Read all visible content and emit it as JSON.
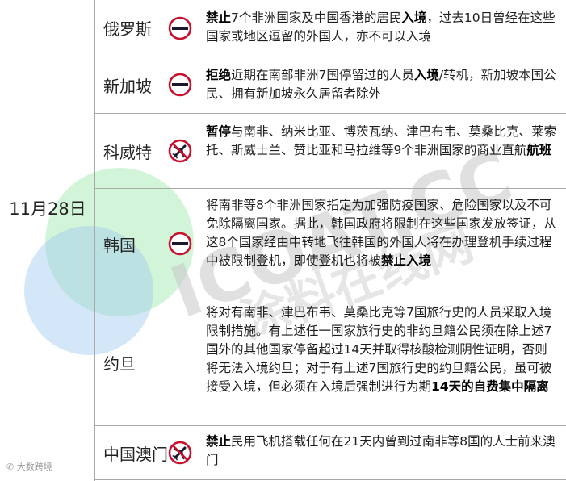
{
  "date": "11月28日",
  "rows": [
    {
      "country": "俄罗斯",
      "icon": "no-entry-icon",
      "text": [
        {
          "b": "禁止"
        },
        {
          "t": "7个非洲国家及中国香港的居民"
        },
        {
          "b": "入境"
        },
        {
          "t": "，过去10日曾经在这些国家或地区逗留的外国人，亦不可以入境"
        }
      ]
    },
    {
      "country": "新加坡",
      "icon": "no-entry-icon",
      "text": [
        {
          "b": "拒绝"
        },
        {
          "t": "近期在南部非洲7国停留过的人员"
        },
        {
          "b": "入境"
        },
        {
          "t": "/转机，新加坡本国公民、拥有新加坡永久居留者除外"
        }
      ]
    },
    {
      "country": "科威特",
      "icon": "no-flights-icon",
      "text": [
        {
          "b": "暂停"
        },
        {
          "t": "与南非、纳米比亚、博茨瓦纳、津巴布韦、莫桑比克、莱索托、斯威士兰、赞比亚和马拉维等9个非洲国家的商业直航"
        },
        {
          "b": "航班"
        }
      ]
    },
    {
      "country": "韩国",
      "icon": "no-entry-icon",
      "text": [
        {
          "t": "将南非等8个非洲国家指定为加强防疫国家、危险国家以及不可免除隔离国家。据此，韩国政府将限制在这些国家发放签证，从这8个国家经由中转地飞往韩国的外国人将在办理登机手续过程中被限制登机，即使登机也将被"
        },
        {
          "b": "禁止入境"
        }
      ]
    },
    {
      "country": "约旦",
      "icon": "",
      "text": [
        {
          "t": "将对有南非、津巴布韦、莫桑比克等7国旅行史的人员采取入境限制措施。有上述任一国家旅行史的非约旦籍公民须在除上述7国外的其他国家停留超过14天并取得核酸检测阴性证明，否则将无法入境约旦；对于有上述7国旅行史的约旦籍公民，虽可被接受入境，但必须在入境后强制进行为期"
        },
        {
          "b": "14天的自费集中隔离"
        }
      ]
    },
    {
      "country": "中国澳门",
      "icon": "no-flights-icon",
      "text": [
        {
          "b": "禁止"
        },
        {
          "t": "民用飞机搭载任何在21天内曾到过南非等8国的人士前来澳门"
        }
      ]
    }
  ],
  "watermark": {
    "brand": "ICOAT.CC",
    "sub": "涂料在线网",
    "colors": {
      "green": "#9be6a9",
      "blue": "#9fcaf0",
      "text": "#c4c4c4"
    }
  },
  "footer": {
    "text": "大数跨境"
  },
  "colors": {
    "icon_red": "#c8102e",
    "icon_dark": "#1a1a2e",
    "grid": "#a9a9a9"
  }
}
